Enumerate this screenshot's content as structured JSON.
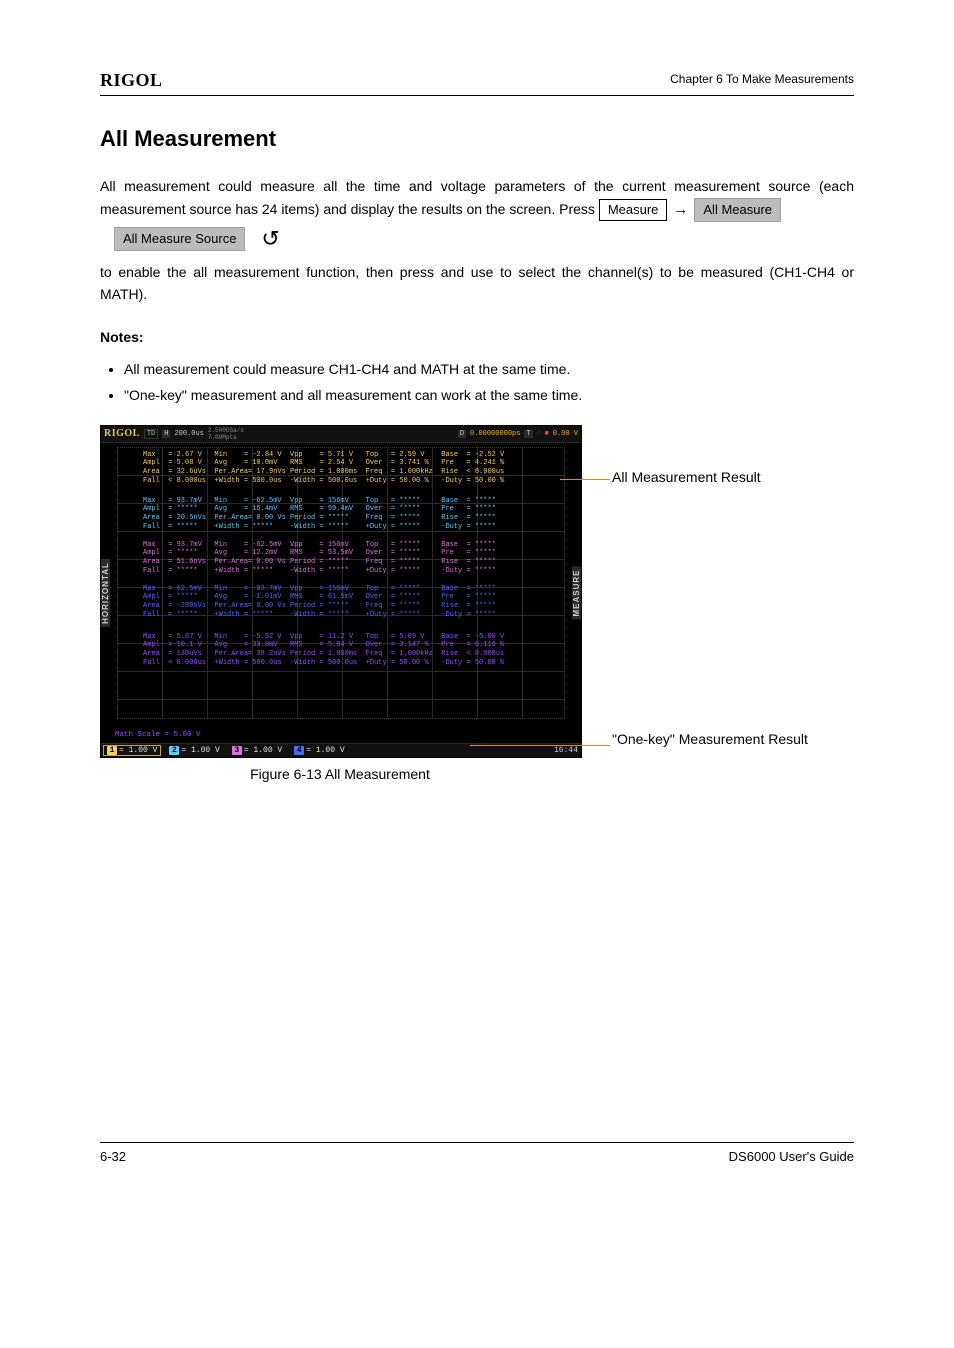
{
  "brand": "RIGOL",
  "chapter": "Chapter 6 To Make Measurements",
  "section_title": "All Measurement",
  "para1_pre": "All measurement could measure all the time and voltage parameters of the current measurement source (each measurement source has 24 items) and display the results on the screen. Press ",
  "hardkey": "Measure",
  "softkey1": "All Measure",
  "para1_post": " to enable the all measurement function, then press ",
  "softkey2": "All Measure Source",
  "para1_tail": " and use ",
  "para1_knob_after": " to select the channel(s) to be measured (CH1-CH4 or MATH).",
  "notes_head": "Notes:",
  "notes": [
    "All measurement could measure CH1-CH4 and MATH at the same time.",
    "\"One-key\" measurement and all measurement can work at the same time."
  ],
  "fig_callout_right": "All Measurement Result",
  "fig_callout_bottom": "\"One-key\" Measurement Result",
  "fig_caption": "Figure 6-13 All Measurement",
  "scope": {
    "logo": "RIGOL",
    "td": "TD",
    "h_icon": "H",
    "hscale": "200.0us",
    "srate_top": "2.500GSa/s",
    "srate_bot": "7.00Mpts",
    "d": "D",
    "d_val": "0.00000000ps",
    "t": "T",
    "t_glyph": "𝄐",
    "t_val": "0.00 V",
    "left_label": "HORIZONTAL",
    "right_label": "MEASURE",
    "math_footer": "Math Scale = 5.00 V",
    "clock": "16:44",
    "channels": [
      {
        "n": "1",
        "v": "= 1.00 V",
        "sel": true
      },
      {
        "n": "2",
        "v": "= 1.00 V",
        "sel": false
      },
      {
        "n": "3",
        "v": "= 1.00 V",
        "sel": false
      },
      {
        "n": "4",
        "v": "= 1.00 V",
        "sel": false
      }
    ],
    "ch1": {
      "rows": [
        "Max   = 2.67 V   Min    = -2.84 V  Vpp    = 5.71 V   Top   = 2.59 V    Base  = -2.52 V",
        "Ampl  = 5.08 V   Avg    = 10.0mV   RMS    = 2.54 V   Over  = 3.741 %   Pre   = 4.241 %",
        "Area  = 32.6uVs  Per.Area= 17.9nVs Period = 1.000ms  Freq  = 1.000kHz  Rise  < 8.000us",
        "Fall  < 8.000us  +Width = 500.0us  -Width = 500.0us  +Duty = 50.00 %   -Duty = 50.00 %"
      ]
    },
    "ch2": {
      "rows": [
        "Max   = 93.7mV   Min    = -62.5mV  Vpp    = 156mV    Top   = *****     Base  = *****",
        "Ampl  = *****    Avg    = 15.4mV   RMS    = 59.4mV   Over  = *****     Pre   = *****",
        "Area  = 20.5nVs  Per.Area= 0.00 Vs Period = *****    Freq  = *****     Rise  = *****",
        "Fall  = *****    +Width = *****    -Width = *****    +Duty = *****     -Duty = *****"
      ]
    },
    "ch3": {
      "rows": [
        "Max   = 93.7mV   Min    = -62.5mV  Vpp    = 156mV    Top   = *****     Base  = *****",
        "Ampl  = *****    Avg    = 12.2mV   RMS    = 53.5mV   Over  = *****     Pre   = *****",
        "Area  = 51.6nVs  Per.Area= 0.00 Vs Period = *****    Freq  = *****     Rise  = *****",
        "Fall  = *****    +Width = *****    -Width = *****    +Duty = *****     -Duty = *****"
      ]
    },
    "ch4": {
      "rows": [
        "Max   = 62.5mV   Min    = -93.7mV  Vpp    = 156mV    Top   = *****     Base  = *****",
        "Ampl  = *****    Avg    = -1.01mV  RMS    = 61.5mV   Over  = *****     Pre   = *****",
        "Area  = -200nVs  Per.Area= 0.00 Vs Period = *****    Freq  = *****     Rise  = *****",
        "Fall  = *****    +Width = *****    -Width = *****    +Duty = *****     -Duty = *****"
      ]
    },
    "math": {
      "rows": [
        "Max   = 5.67 V   Min    = -5.52 V  Vpp    = 11.2 V   Top   = 5.09 V    Base  = -5.00 V",
        "Ampl  = 10.1 V   Avg    = 33.8mV   RMS    = 5.04 V   Over  = 3.147 %   Pre   = 6.116 %",
        "Area  = 130uVs   Per.Area= 38.2nVs Period = 1.000ms  Freq  = 1.000kHz  Rise  < 8.000us",
        "Fall  < 8.000us  +Width = 500.0us  -Width = 500.0us  +Duty = 50.00 %   -Duty = 50.00 %"
      ]
    }
  },
  "footer_page": "6-32",
  "footer_model": "DS6000 User's Guide"
}
